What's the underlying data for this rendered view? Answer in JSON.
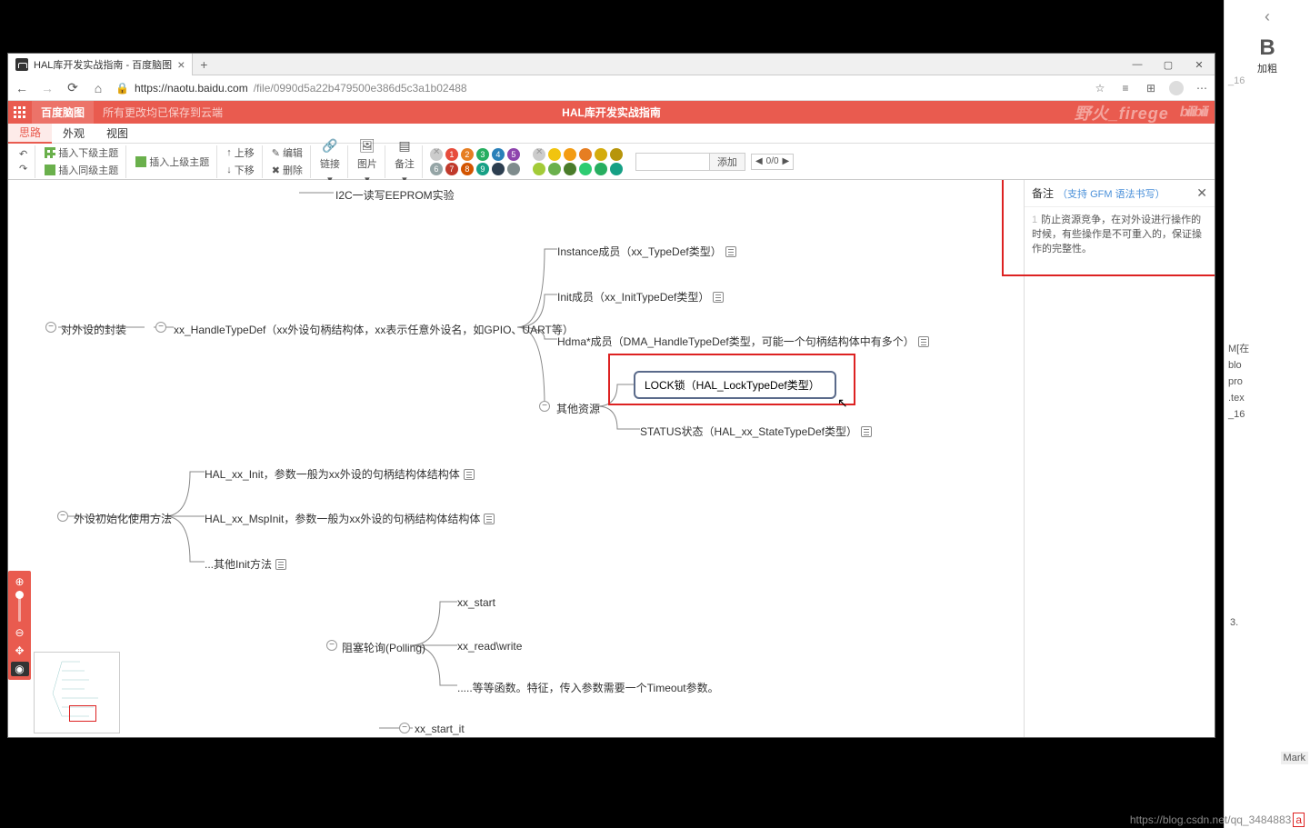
{
  "tab": {
    "title": "HAL库开发实战指南 - 百度脑图"
  },
  "url": {
    "domain": "https://naotu.baidu.com",
    "path": "/file/0990d5a22b479500e386d5c3a1b02488"
  },
  "appbar": {
    "brand": "百度脑图",
    "saved": "所有更改均已保存到云端",
    "title": "HAL库开发实战指南",
    "watermark_left": "野火_firege",
    "watermark_right": "bilibili"
  },
  "subtabs": {
    "a": "思路",
    "b": "外观",
    "c": "视图"
  },
  "toolbar": {
    "undo": "↶",
    "redo": "↷",
    "insert_child": "插入下级主题",
    "insert_sibling": "插入同级主题",
    "insert_parent": "插入上级主题",
    "up": "上移",
    "down": "下移",
    "edit": "编辑",
    "delete": "删除",
    "link": "链接",
    "image": "图片",
    "note": "备注",
    "add": "添加",
    "page": "0/0"
  },
  "colors": {
    "row1": [
      "#e74c3c",
      "#e67e22",
      "#27ae60",
      "#2980b9",
      "#8e44ad",
      "#f39c12"
    ],
    "row2": [
      "#95a5a6",
      "#c0392b",
      "#d35400",
      "#16a085",
      "#2c3e50",
      "#7f8c8d"
    ],
    "row3": [
      "#f1c40f",
      "#2ecc71",
      "#3498db",
      "#1abc9c",
      "#9b59b6",
      "#34495e"
    ]
  },
  "nodes": {
    "i2c": "I2C一读写EEPROM实验",
    "wrap": "对外设的封装",
    "handle": "xx_HandleTypeDef（xx外设句柄结构体，xx表示任意外设名，如GPIO、UART等）",
    "instance": "Instance成员（xx_TypeDef类型）",
    "init": "Init成员（xx_InitTypeDef类型）",
    "hdma": "Hdma*成员（DMA_HandleTypeDef类型，可能一个句柄结构体中有多个）",
    "other": "其他资源",
    "lock": "LOCK锁（HAL_LockTypeDef类型）",
    "status": "STATUS状态（HAL_xx_StateTypeDef类型）",
    "initway": "外设初始化使用方法",
    "halinit": "HAL_xx_Init，参数一般为xx外设的句柄结构体结构体",
    "mspinit": "HAL_xx_MspInit，参数一般为xx外设的句柄结构体结构体",
    "otherinit": "...其他Init方法",
    "polling": "阻塞轮询(Polling)",
    "xxstart": "xx_start",
    "xxrw": "xx_read\\write",
    "xxetc": ".....等等函数。特征，传入参数需要一个Timeout参数。",
    "xxstartit": "xx_start_it"
  },
  "notes": {
    "title": "备注",
    "hint": "（支持 GFM 语法书写）",
    "line": "防止资源竞争，在对外设进行操作的时候，有些操作是不可重入的，保证操作的完整性。"
  },
  "right": {
    "b": "B",
    "bold": "加粗",
    "n1": "_16",
    "n3": "3.",
    "mark": "Mark",
    "frag1": "M[在",
    "frag2": "blo",
    "frag3": "pro",
    "frag4": ".tex",
    "frag5": "_16"
  },
  "wm": {
    "text": "https://blog.csdn.net/qq_3484883",
    "badge": "a"
  }
}
